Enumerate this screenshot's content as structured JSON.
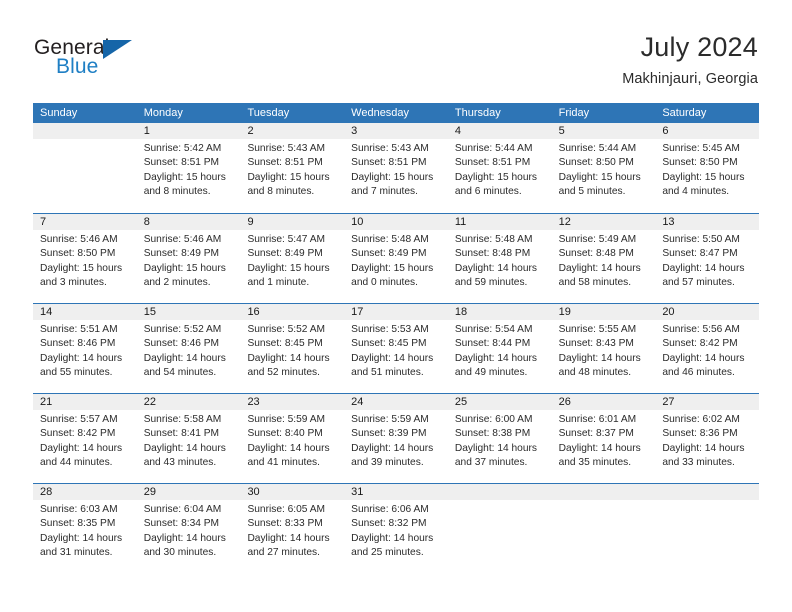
{
  "brand": {
    "name_part1": "General",
    "name_part2": "Blue",
    "triangle_icon": "triangle-icon",
    "colors": {
      "dark": "#231f20",
      "blue": "#1f7fc4",
      "triangle": "#1565a8"
    }
  },
  "header": {
    "title": "July 2024",
    "location": "Makhinjauri, Georgia"
  },
  "theme": {
    "header_blue": "#2e75b6",
    "row_band_gray": "#efefef",
    "text": "#2b2b2b"
  },
  "weekdays": [
    "Sunday",
    "Monday",
    "Tuesday",
    "Wednesday",
    "Thursday",
    "Friday",
    "Saturday"
  ],
  "calendar": {
    "month": "July",
    "year": 2024,
    "weeks": [
      [
        {
          "day": "",
          "sunrise": "",
          "sunset": "",
          "daylight_line1": "",
          "daylight_line2": "",
          "empty": true
        },
        {
          "day": "1",
          "sunrise": "Sunrise: 5:42 AM",
          "sunset": "Sunset: 8:51 PM",
          "daylight_line1": "Daylight: 15 hours",
          "daylight_line2": "and 8 minutes."
        },
        {
          "day": "2",
          "sunrise": "Sunrise: 5:43 AM",
          "sunset": "Sunset: 8:51 PM",
          "daylight_line1": "Daylight: 15 hours",
          "daylight_line2": "and 8 minutes."
        },
        {
          "day": "3",
          "sunrise": "Sunrise: 5:43 AM",
          "sunset": "Sunset: 8:51 PM",
          "daylight_line1": "Daylight: 15 hours",
          "daylight_line2": "and 7 minutes."
        },
        {
          "day": "4",
          "sunrise": "Sunrise: 5:44 AM",
          "sunset": "Sunset: 8:51 PM",
          "daylight_line1": "Daylight: 15 hours",
          "daylight_line2": "and 6 minutes."
        },
        {
          "day": "5",
          "sunrise": "Sunrise: 5:44 AM",
          "sunset": "Sunset: 8:50 PM",
          "daylight_line1": "Daylight: 15 hours",
          "daylight_line2": "and 5 minutes."
        },
        {
          "day": "6",
          "sunrise": "Sunrise: 5:45 AM",
          "sunset": "Sunset: 8:50 PM",
          "daylight_line1": "Daylight: 15 hours",
          "daylight_line2": "and 4 minutes."
        }
      ],
      [
        {
          "day": "7",
          "sunrise": "Sunrise: 5:46 AM",
          "sunset": "Sunset: 8:50 PM",
          "daylight_line1": "Daylight: 15 hours",
          "daylight_line2": "and 3 minutes."
        },
        {
          "day": "8",
          "sunrise": "Sunrise: 5:46 AM",
          "sunset": "Sunset: 8:49 PM",
          "daylight_line1": "Daylight: 15 hours",
          "daylight_line2": "and 2 minutes."
        },
        {
          "day": "9",
          "sunrise": "Sunrise: 5:47 AM",
          "sunset": "Sunset: 8:49 PM",
          "daylight_line1": "Daylight: 15 hours",
          "daylight_line2": "and 1 minute."
        },
        {
          "day": "10",
          "sunrise": "Sunrise: 5:48 AM",
          "sunset": "Sunset: 8:49 PM",
          "daylight_line1": "Daylight: 15 hours",
          "daylight_line2": "and 0 minutes."
        },
        {
          "day": "11",
          "sunrise": "Sunrise: 5:48 AM",
          "sunset": "Sunset: 8:48 PM",
          "daylight_line1": "Daylight: 14 hours",
          "daylight_line2": "and 59 minutes."
        },
        {
          "day": "12",
          "sunrise": "Sunrise: 5:49 AM",
          "sunset": "Sunset: 8:48 PM",
          "daylight_line1": "Daylight: 14 hours",
          "daylight_line2": "and 58 minutes."
        },
        {
          "day": "13",
          "sunrise": "Sunrise: 5:50 AM",
          "sunset": "Sunset: 8:47 PM",
          "daylight_line1": "Daylight: 14 hours",
          "daylight_line2": "and 57 minutes."
        }
      ],
      [
        {
          "day": "14",
          "sunrise": "Sunrise: 5:51 AM",
          "sunset": "Sunset: 8:46 PM",
          "daylight_line1": "Daylight: 14 hours",
          "daylight_line2": "and 55 minutes."
        },
        {
          "day": "15",
          "sunrise": "Sunrise: 5:52 AM",
          "sunset": "Sunset: 8:46 PM",
          "daylight_line1": "Daylight: 14 hours",
          "daylight_line2": "and 54 minutes."
        },
        {
          "day": "16",
          "sunrise": "Sunrise: 5:52 AM",
          "sunset": "Sunset: 8:45 PM",
          "daylight_line1": "Daylight: 14 hours",
          "daylight_line2": "and 52 minutes."
        },
        {
          "day": "17",
          "sunrise": "Sunrise: 5:53 AM",
          "sunset": "Sunset: 8:45 PM",
          "daylight_line1": "Daylight: 14 hours",
          "daylight_line2": "and 51 minutes."
        },
        {
          "day": "18",
          "sunrise": "Sunrise: 5:54 AM",
          "sunset": "Sunset: 8:44 PM",
          "daylight_line1": "Daylight: 14 hours",
          "daylight_line2": "and 49 minutes."
        },
        {
          "day": "19",
          "sunrise": "Sunrise: 5:55 AM",
          "sunset": "Sunset: 8:43 PM",
          "daylight_line1": "Daylight: 14 hours",
          "daylight_line2": "and 48 minutes."
        },
        {
          "day": "20",
          "sunrise": "Sunrise: 5:56 AM",
          "sunset": "Sunset: 8:42 PM",
          "daylight_line1": "Daylight: 14 hours",
          "daylight_line2": "and 46 minutes."
        }
      ],
      [
        {
          "day": "21",
          "sunrise": "Sunrise: 5:57 AM",
          "sunset": "Sunset: 8:42 PM",
          "daylight_line1": "Daylight: 14 hours",
          "daylight_line2": "and 44 minutes."
        },
        {
          "day": "22",
          "sunrise": "Sunrise: 5:58 AM",
          "sunset": "Sunset: 8:41 PM",
          "daylight_line1": "Daylight: 14 hours",
          "daylight_line2": "and 43 minutes."
        },
        {
          "day": "23",
          "sunrise": "Sunrise: 5:59 AM",
          "sunset": "Sunset: 8:40 PM",
          "daylight_line1": "Daylight: 14 hours",
          "daylight_line2": "and 41 minutes."
        },
        {
          "day": "24",
          "sunrise": "Sunrise: 5:59 AM",
          "sunset": "Sunset: 8:39 PM",
          "daylight_line1": "Daylight: 14 hours",
          "daylight_line2": "and 39 minutes."
        },
        {
          "day": "25",
          "sunrise": "Sunrise: 6:00 AM",
          "sunset": "Sunset: 8:38 PM",
          "daylight_line1": "Daylight: 14 hours",
          "daylight_line2": "and 37 minutes."
        },
        {
          "day": "26",
          "sunrise": "Sunrise: 6:01 AM",
          "sunset": "Sunset: 8:37 PM",
          "daylight_line1": "Daylight: 14 hours",
          "daylight_line2": "and 35 minutes."
        },
        {
          "day": "27",
          "sunrise": "Sunrise: 6:02 AM",
          "sunset": "Sunset: 8:36 PM",
          "daylight_line1": "Daylight: 14 hours",
          "daylight_line2": "and 33 minutes."
        }
      ],
      [
        {
          "day": "28",
          "sunrise": "Sunrise: 6:03 AM",
          "sunset": "Sunset: 8:35 PM",
          "daylight_line1": "Daylight: 14 hours",
          "daylight_line2": "and 31 minutes."
        },
        {
          "day": "29",
          "sunrise": "Sunrise: 6:04 AM",
          "sunset": "Sunset: 8:34 PM",
          "daylight_line1": "Daylight: 14 hours",
          "daylight_line2": "and 30 minutes."
        },
        {
          "day": "30",
          "sunrise": "Sunrise: 6:05 AM",
          "sunset": "Sunset: 8:33 PM",
          "daylight_line1": "Daylight: 14 hours",
          "daylight_line2": "and 27 minutes."
        },
        {
          "day": "31",
          "sunrise": "Sunrise: 6:06 AM",
          "sunset": "Sunset: 8:32 PM",
          "daylight_line1": "Daylight: 14 hours",
          "daylight_line2": "and 25 minutes."
        },
        {
          "day": "",
          "sunrise": "",
          "sunset": "",
          "daylight_line1": "",
          "daylight_line2": "",
          "empty": true
        },
        {
          "day": "",
          "sunrise": "",
          "sunset": "",
          "daylight_line1": "",
          "daylight_line2": "",
          "empty": true
        },
        {
          "day": "",
          "sunrise": "",
          "sunset": "",
          "daylight_line1": "",
          "daylight_line2": "",
          "empty": true
        }
      ]
    ]
  }
}
